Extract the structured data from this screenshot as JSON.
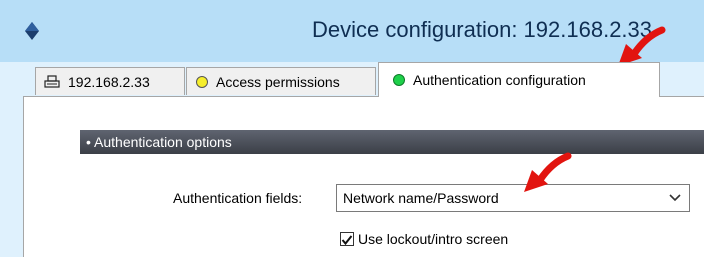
{
  "window": {
    "title": "Device configuration: 192.168.2.33"
  },
  "tabs": [
    {
      "label": "192.168.2.33",
      "icon": "printer-icon"
    },
    {
      "label": "Access permissions",
      "icon": "yellow-status-dot",
      "status_color": "#f6ee2c"
    },
    {
      "label": "Authentication configuration",
      "icon": "green-status-dot",
      "status_color": "#1ed04a",
      "active": true
    }
  ],
  "section": {
    "header": "• Authentication options"
  },
  "fields": {
    "auth_label": "Authentication fields:",
    "auth_value": "Network name/Password"
  },
  "checkbox": {
    "label": "Use lockout/intro screen",
    "checked": true
  },
  "colors": {
    "title_bar": "#b7def7",
    "annotation_arrow": "#e2140f"
  }
}
